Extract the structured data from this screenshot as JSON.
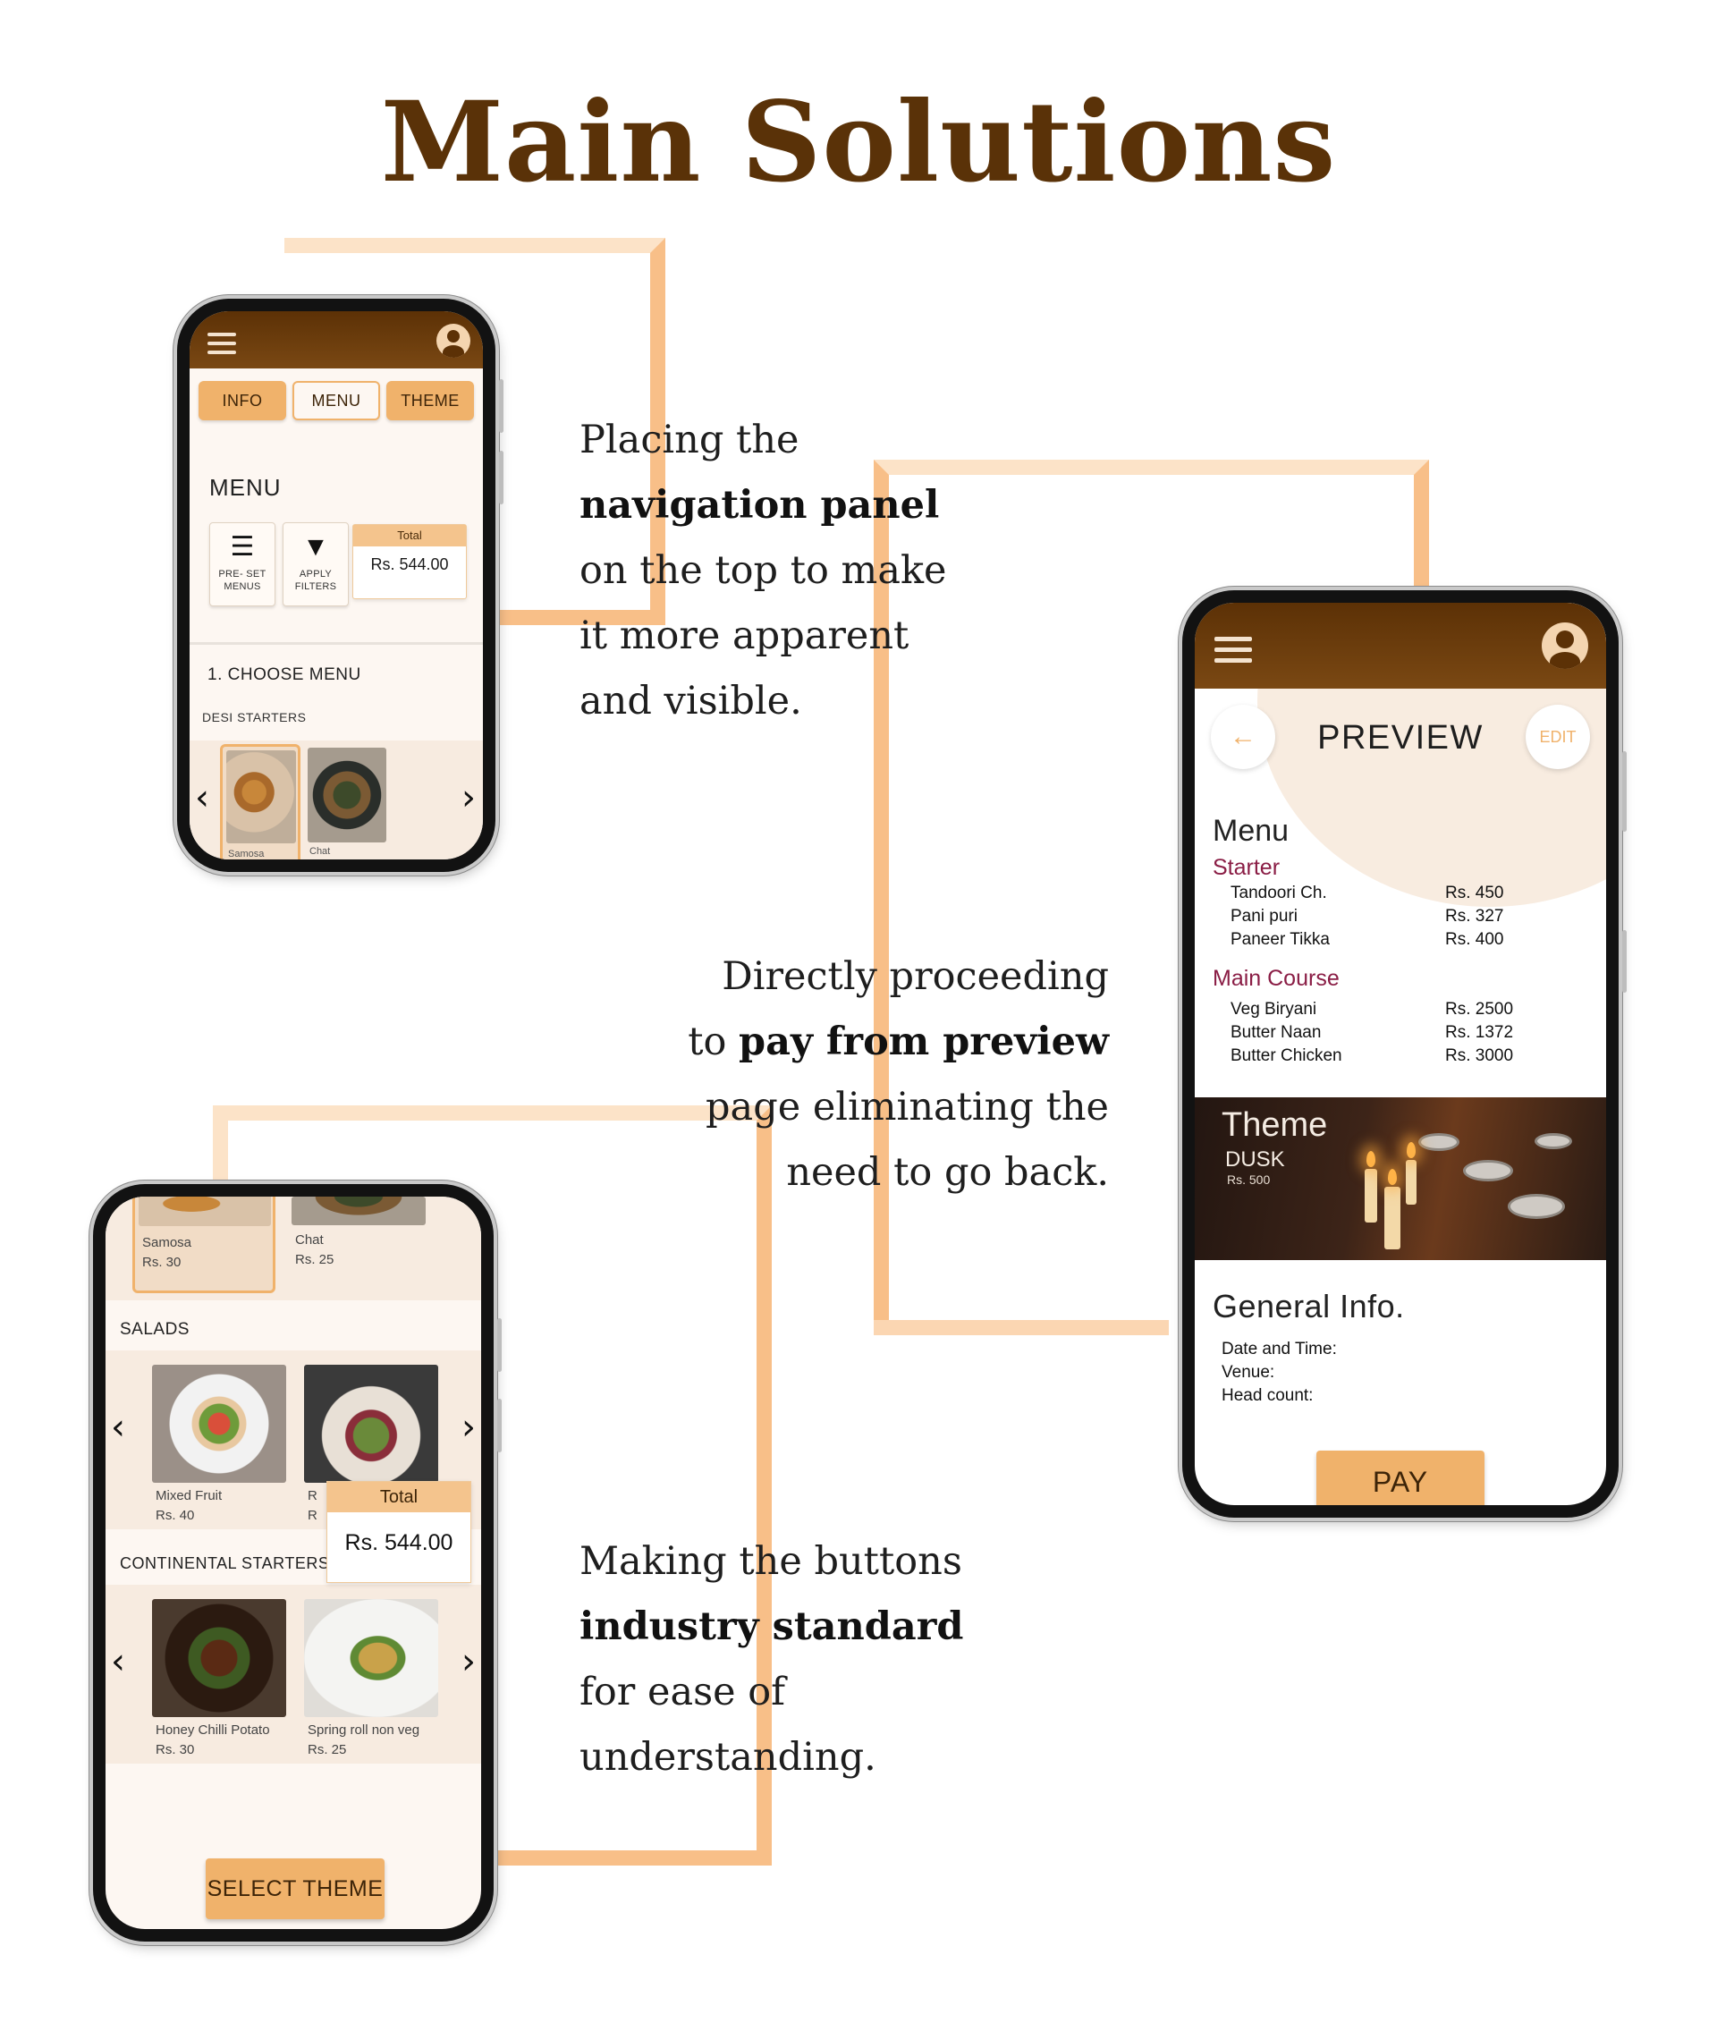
{
  "page": {
    "title": "Main Solutions"
  },
  "captions": {
    "c1": {
      "l1": "Placing the",
      "l2": "navigation panel",
      "l3": "on the top to make",
      "l4": "it more apparent",
      "l5": "and visible."
    },
    "c2": {
      "l1": "Directly proceeding",
      "l2a": "to ",
      "l2b": "pay from preview",
      "l3": "page eliminating the",
      "l4": "need to go back."
    },
    "c3": {
      "l1": "Making the buttons",
      "l2": "industry standard",
      "l3": "for ease of",
      "l4": "understanding."
    }
  },
  "phone_menu": {
    "tabs": [
      "INFO",
      "MENU",
      "THEME"
    ],
    "heading": "MENU",
    "tiles": [
      {
        "icon": "list-icon",
        "label1": "PRE- SET",
        "label2": "MENUS"
      },
      {
        "icon": "filter-icon",
        "label1": "APPLY",
        "label2": "FILTERS"
      }
    ],
    "total_label": "Total",
    "total_value": "Rs. 544.00",
    "step": "1. CHOOSE MENU",
    "category": "DESI STARTERS",
    "items": [
      "Samosa",
      "Chat"
    ]
  },
  "phone_preview": {
    "title": "PREVIEW",
    "edit": "EDIT",
    "back_icon": "arrow-left-icon",
    "menu_heading": "Menu",
    "starter_heading": "Starter",
    "starters": [
      {
        "name": "Tandoori Ch.",
        "price": "Rs. 450"
      },
      {
        "name": "Pani puri",
        "price": "Rs. 327"
      },
      {
        "name": "Paneer Tikka",
        "price": "Rs. 400"
      }
    ],
    "main_heading": "Main Course",
    "mains": [
      {
        "name": "Veg Biryani",
        "price": "Rs. 2500"
      },
      {
        "name": "Butter Naan",
        "price": "Rs. 1372"
      },
      {
        "name": "Butter Chicken",
        "price": "Rs. 3000"
      }
    ],
    "theme_heading": "Theme",
    "theme_name": "DUSK",
    "theme_price": "Rs. 500",
    "general_heading": "General Info.",
    "info_lines": [
      "Date and Time:",
      "Venue:",
      "Head count:"
    ],
    "pay": "PAY"
  },
  "phone_select": {
    "top_items": [
      {
        "name": "Samosa",
        "price": "Rs. 30"
      },
      {
        "name": "Chat",
        "price": "Rs. 25"
      }
    ],
    "salads_heading": "SALADS",
    "salads": [
      {
        "name": "Mixed Fruit",
        "price": "Rs. 40"
      },
      {
        "name": "R",
        "price": "R"
      }
    ],
    "continental_heading": "CONTINENTAL STARTERS",
    "continental": [
      {
        "name": "Honey Chilli Potato",
        "price": "Rs. 30"
      },
      {
        "name": "Spring roll non veg",
        "price": "Rs. 25"
      }
    ],
    "total_label": "Total",
    "total_value": "Rs. 544.00",
    "select_theme": "SELECT THEME"
  },
  "colors": {
    "brown": "#5a3208",
    "accent": "#f0b26b",
    "connector": "#f8bf88",
    "section_red": "#8a1d45"
  }
}
